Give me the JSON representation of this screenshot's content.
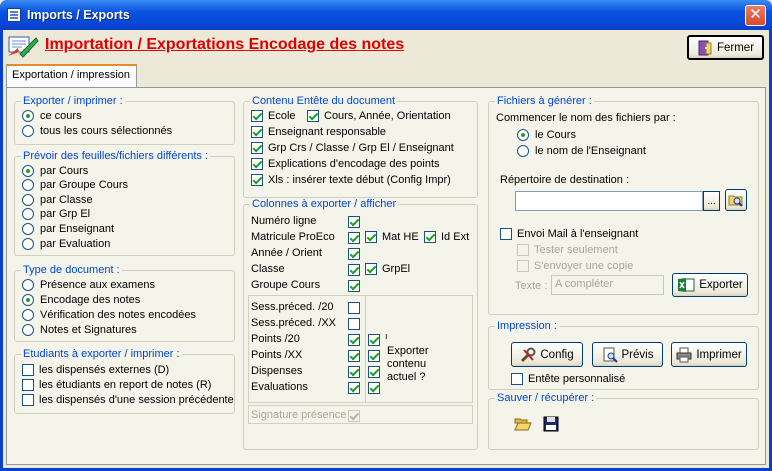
{
  "window": {
    "title": "Imports / Exports",
    "close_glyph": "✕"
  },
  "header": {
    "heading": "Importation / Exportations Encodage des notes",
    "close_button": "Fermer"
  },
  "tabs": [
    {
      "label": "Exportation / impression"
    }
  ],
  "export_print": {
    "title": "Exporter / imprimer :",
    "options": [
      {
        "label": "ce cours",
        "selected": true
      },
      {
        "label": "tous les cours sélectionnés",
        "selected": false
      }
    ]
  },
  "separate_files": {
    "title": "Prévoir des feuilles/fichiers différents :",
    "options": [
      {
        "label": "par Cours",
        "selected": true
      },
      {
        "label": "par Groupe Cours",
        "selected": false
      },
      {
        "label": "par Classe",
        "selected": false
      },
      {
        "label": "par Grp El",
        "selected": false
      },
      {
        "label": "par Enseignant",
        "selected": false
      },
      {
        "label": "par Evaluation",
        "selected": false
      }
    ]
  },
  "doc_type": {
    "title": "Type de document :",
    "options": [
      {
        "label": "Présence aux examens",
        "selected": false
      },
      {
        "label": "Encodage des notes",
        "selected": true
      },
      {
        "label": "Vérification des notes encodées",
        "selected": false
      },
      {
        "label": "Notes et Signatures",
        "selected": false
      }
    ]
  },
  "students": {
    "title": "Etudiants à exporter / imprimer :",
    "options": [
      {
        "label": "les dispensés externes (D)",
        "checked": false
      },
      {
        "label": "les étudiants en report de notes (R)",
        "checked": false
      },
      {
        "label": "les dispensés d'une session précédente",
        "checked": false
      }
    ]
  },
  "doc_header": {
    "title": "Contenu Entête du document",
    "ecole": "Ecole",
    "cours_annee": "Cours, Année, Orientation",
    "enseignant": "Enseignant responsable",
    "grp": "Grp Crs / Classe / Grp El / Enseignant",
    "explications": "Explications d'encodage des points",
    "xls": "Xls : insérer texte début (Config Impr)"
  },
  "columns": {
    "title": "Colonnes à exporter / afficher",
    "numero": "Numéro ligne",
    "matricule": "Matricule ProEco",
    "mat_he": "Mat HE",
    "id_ext": "Id Ext",
    "annee": "Année / Orient",
    "classe": "Classe",
    "grp_el": "GrpEl",
    "groupe_cours": "Groupe Cours",
    "sess20": "Sess.préced. /20",
    "sessxx": "Sess.préced. /XX",
    "points20": "Points /20",
    "pointsxx": "Points /XX",
    "dispenses": "Dispenses",
    "evaluations": "Evaluations",
    "export_current": "Exporter contenu actuel ?",
    "signature": "Signature présence"
  },
  "files": {
    "title": "Fichiers à générer :",
    "prefix_label": "Commencer le nom des fichiers par :",
    "options": [
      {
        "label": "le Cours",
        "selected": true
      },
      {
        "label": "le nom de l'Enseignant",
        "selected": false
      }
    ],
    "dest_label": "Répertoire de destination :",
    "dest_value": "",
    "browse_glyph": "...",
    "mail": "Envoi Mail à l'enseignant",
    "test_only": "Tester seulement",
    "send_copy": "S'envoyer une copie",
    "text_label": "Texte :",
    "text_value": "A compléter",
    "export_button": "Exporter"
  },
  "print": {
    "title": "Impression :",
    "config": "Config",
    "preview": "Prévis",
    "print": "Imprimer",
    "custom_header": "Entête personnalisé"
  },
  "save": {
    "title": "Sauver / récupérer :"
  },
  "colors": {
    "heading": "#e00000",
    "group_title": "#0046d5",
    "check": "#21a121"
  }
}
